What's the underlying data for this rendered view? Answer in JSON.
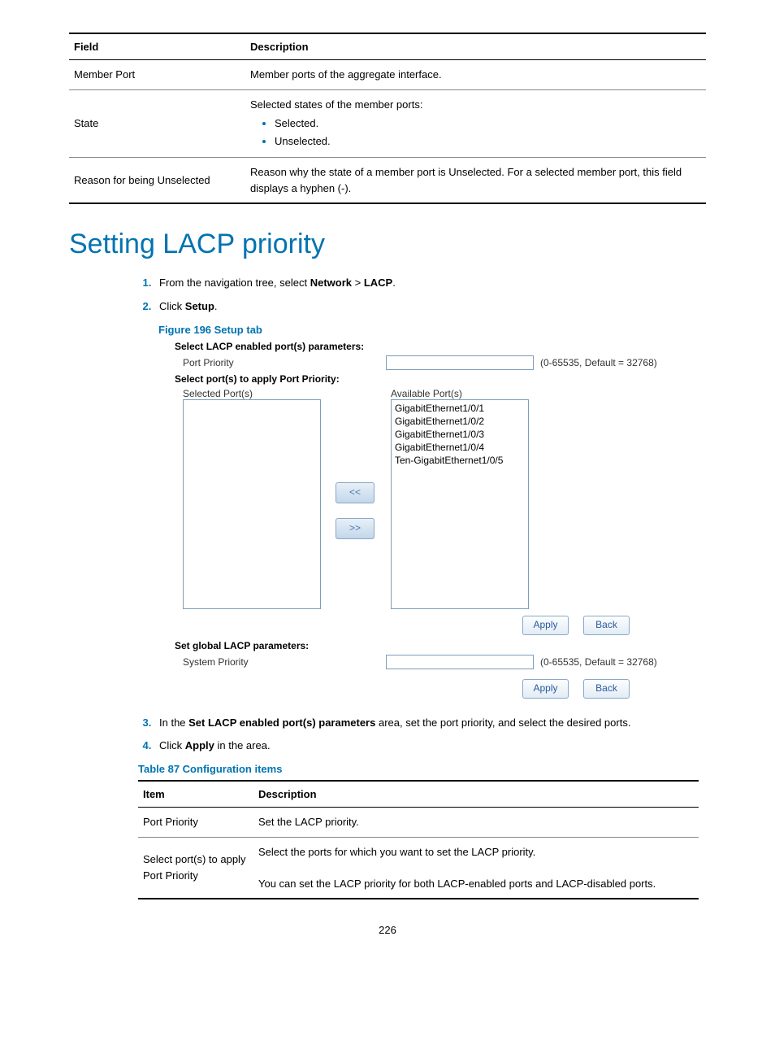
{
  "table1": {
    "headers": {
      "field": "Field",
      "description": "Description"
    },
    "rows": [
      {
        "field": "Member Port",
        "desc": "Member ports of the aggregate interface."
      },
      {
        "field": "State",
        "desc_intro": "Selected states of the member ports:",
        "bullets": [
          "Selected.",
          "Unselected."
        ]
      },
      {
        "field": "Reason for being Unselected",
        "desc": "Reason why the state of a member port is Unselected. For a selected member port, this field displays a hyphen (-)."
      }
    ]
  },
  "heading": "Setting LACP priority",
  "steps_part1": [
    {
      "pre": "From the navigation tree, select ",
      "b1": "Network",
      "mid": " > ",
      "b2": "LACP",
      "post": "."
    },
    {
      "pre": "Click ",
      "b1": "Setup",
      "post": "."
    }
  ],
  "figure_caption": "Figure 196 Setup tab",
  "screenshot": {
    "section1_title": "Select LACP enabled port(s) parameters:",
    "port_priority_label": "Port Priority",
    "port_priority_hint": "(0-65535, Default = 32768)",
    "select_ports_title": "Select port(s) to apply Port Priority:",
    "selected_ports_label": "Selected Port(s)",
    "available_ports_label": "Available Port(s)",
    "available_ports": [
      "GigabitEthernet1/0/1",
      "GigabitEthernet1/0/2",
      "GigabitEthernet1/0/3",
      "GigabitEthernet1/0/4",
      "Ten-GigabitEthernet1/0/5"
    ],
    "move_left": "<<",
    "move_right": ">>",
    "apply": "Apply",
    "back": "Back",
    "section2_title": "Set global LACP parameters:",
    "system_priority_label": "System Priority",
    "system_priority_hint": "(0-65535, Default = 32768)"
  },
  "steps_part2": [
    {
      "pre": "In the ",
      "b1": "Set LACP enabled port(s) parameters",
      "post": " area, set the port priority, and select the desired ports."
    },
    {
      "pre": "Click ",
      "b1": "Apply",
      "post": " in the area."
    }
  ],
  "table_caption": "Table 87 Configuration items",
  "table2": {
    "headers": {
      "item": "Item",
      "description": "Description"
    },
    "rows": [
      {
        "item": "Port Priority",
        "desc_lines": [
          "Set the LACP priority."
        ]
      },
      {
        "item": "Select port(s) to apply Port Priority",
        "desc_lines": [
          "Select the ports for which you want to set the LACP priority.",
          "You can set the LACP priority for both LACP-enabled ports and LACP-disabled ports."
        ]
      }
    ]
  },
  "page_number": "226"
}
